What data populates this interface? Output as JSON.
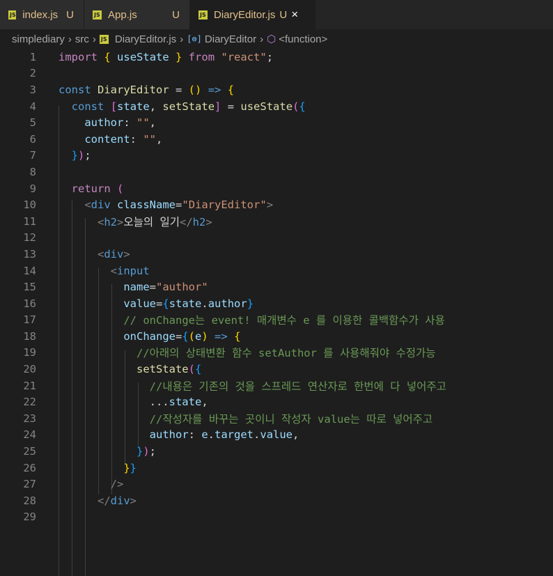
{
  "tabs": [
    {
      "label": "index.js",
      "status": "U"
    },
    {
      "label": "App.js",
      "status": "U"
    },
    {
      "label": "DiaryEditor.js",
      "status": "U"
    }
  ],
  "breadcrumb": {
    "items": [
      "simplediary",
      "src",
      "DiaryEditor.js",
      "DiaryEditor",
      "<function>"
    ]
  },
  "icons": {
    "js_icon": "JS",
    "close": "×",
    "chevron": "›"
  },
  "lines": [
    {
      "n": "1",
      "html": "<span class=\"imp\">import</span> <span class=\"br1\">{</span> <span class=\"var\">useState</span> <span class=\"br1\">}</span> <span class=\"imp\">from</span> <span class=\"str\">\"react\"</span>;"
    },
    {
      "n": "2",
      "html": ""
    },
    {
      "n": "3",
      "html": "<span class=\"kw\">const</span> <span class=\"fn\">DiaryEditor</span> = <span class=\"br1\">()</span> <span class=\"kw\">=&gt;</span> <span class=\"br1\">{</span>"
    },
    {
      "n": "4",
      "html": "  <span class=\"kw\">const</span> <span class=\"br2\">[</span><span class=\"var\">state</span>, <span class=\"fn\">setState</span><span class=\"br2\">]</span> = <span class=\"fn\">useState</span><span class=\"br2\">(</span><span class=\"br3\">{</span>"
    },
    {
      "n": "5",
      "html": "    <span class=\"var\">author</span>: <span class=\"str\">\"\"</span>,"
    },
    {
      "n": "6",
      "html": "    <span class=\"var\">content</span>: <span class=\"str\">\"\"</span>,"
    },
    {
      "n": "7",
      "html": "  <span class=\"br3\">}</span><span class=\"br2\">)</span>;"
    },
    {
      "n": "8",
      "html": ""
    },
    {
      "n": "9",
      "html": "  <span class=\"imp\">return</span> <span class=\"br2\">(</span>"
    },
    {
      "n": "10",
      "html": "    <span class=\"tb\">&lt;</span><span class=\"tag\">div</span> <span class=\"attr\">className</span>=<span class=\"str\">\"DiaryEditor\"</span><span class=\"tb\">&gt;</span>"
    },
    {
      "n": "11",
      "html": "      <span class=\"tb\">&lt;</span><span class=\"tag\">h2</span><span class=\"tb\">&gt;</span><span class=\"txt\">오늘의 일기</span><span class=\"tb\">&lt;/</span><span class=\"tag\">h2</span><span class=\"tb\">&gt;</span>"
    },
    {
      "n": "12",
      "html": ""
    },
    {
      "n": "13",
      "html": "      <span class=\"tb\">&lt;</span><span class=\"tag\">div</span><span class=\"tb\">&gt;</span>"
    },
    {
      "n": "14",
      "html": "        <span class=\"tb\">&lt;</span><span class=\"tag\">input</span>"
    },
    {
      "n": "15",
      "html": "          <span class=\"attr\">name</span>=<span class=\"str\">\"author\"</span>"
    },
    {
      "n": "16",
      "html": "          <span class=\"attr\">value</span>=<span class=\"br3\">{</span><span class=\"var\">state</span>.<span class=\"var\">author</span><span class=\"br3\">}</span>"
    },
    {
      "n": "17",
      "html": "          <span class=\"cmt\">// onChange는 event! 매개변수 e 를 이용한 콜백함수가 사용</span>"
    },
    {
      "n": "18",
      "html": "          <span class=\"attr\">onChange</span>=<span class=\"br3\">{</span><span class=\"br1\">(</span><span class=\"var\">e</span><span class=\"br1\">)</span> <span class=\"kw\">=&gt;</span> <span class=\"br1\">{</span>"
    },
    {
      "n": "19",
      "html": "            <span class=\"cmt\">//아래의 상태변환 함수 setAuthor 를 사용해줘야 수정가능</span>"
    },
    {
      "n": "20",
      "html": "            <span class=\"fn\">setState</span><span class=\"br2\">(</span><span class=\"br3\">{</span>"
    },
    {
      "n": "21",
      "html": "              <span class=\"cmt\">//내용은 기존의 것을 스프레드 연산자로 한번에 다 넣어주고</span>"
    },
    {
      "n": "22",
      "html": "              ...<span class=\"var\">state</span>,"
    },
    {
      "n": "23",
      "html": "              <span class=\"cmt\">//작성자를 바꾸는 곳이니 작성자 value는 따로 넣어주고</span>"
    },
    {
      "n": "24",
      "html": "              <span class=\"var\">author</span>: <span class=\"var\">e</span>.<span class=\"var\">target</span>.<span class=\"var\">value</span>,"
    },
    {
      "n": "25",
      "html": "            <span class=\"br3\">}</span><span class=\"br2\">)</span>;"
    },
    {
      "n": "26",
      "html": "          <span class=\"br1\">}</span><span class=\"br3\">}</span>"
    },
    {
      "n": "27",
      "html": "        <span class=\"tb\">/&gt;</span>"
    },
    {
      "n": "28",
      "html": "      <span class=\"tb\">&lt;/</span><span class=\"tag\">div</span><span class=\"tb\">&gt;</span>"
    },
    {
      "n": "29",
      "html": ""
    }
  ]
}
